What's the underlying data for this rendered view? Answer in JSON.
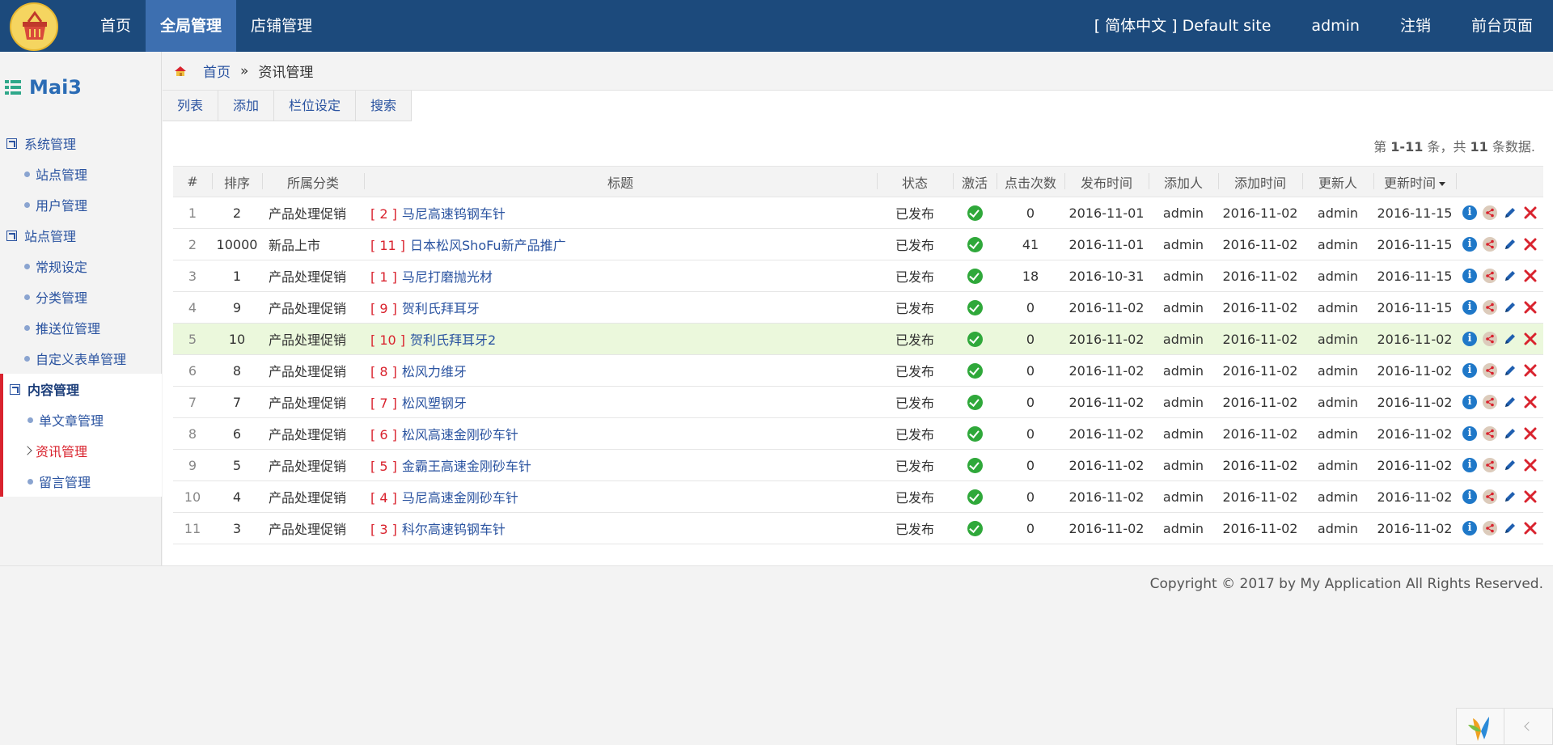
{
  "topnav": {
    "items": [
      {
        "label": "首页"
      },
      {
        "label": "全局管理",
        "active": true
      },
      {
        "label": "店铺管理"
      }
    ],
    "right": {
      "language": "[ 简体中文 ] Default site",
      "user": "admin",
      "logout": "注销",
      "frontend": "前台页面"
    }
  },
  "sidebar": {
    "brand": "Mai3",
    "groups": [
      {
        "label": "系统管理",
        "items": [
          "站点管理",
          "用户管理"
        ]
      },
      {
        "label": "站点管理",
        "items": [
          "常规设定",
          "分类管理",
          "推送位管理",
          "自定义表单管理"
        ]
      },
      {
        "label": "内容管理",
        "items": [
          "单文章管理",
          "资讯管理",
          "留言管理"
        ],
        "open": true,
        "active_item": "资讯管理"
      }
    ]
  },
  "breadcrumb": {
    "home": "首页",
    "sep": "»",
    "current": "资讯管理"
  },
  "tabs": [
    "列表",
    "添加",
    "栏位设定",
    "搜索"
  ],
  "summary": {
    "prefix": "第",
    "range": "1-11",
    "mid": "条，共",
    "total": "11",
    "suffix": "条数据."
  },
  "table": {
    "headers": [
      "#",
      "排序",
      "所属分类",
      "标题",
      "状态",
      "激活",
      "点击次数",
      "发布时间",
      "添加人",
      "添加时间",
      "更新人",
      "更新时间",
      ""
    ],
    "rows": [
      {
        "idx": "1",
        "sort": "2",
        "cat": "产品处理促销",
        "num": "[ 2 ]",
        "title": "马尼高速钨钢车针",
        "status": "已发布",
        "clicks": "0",
        "pub": "2016-11-01",
        "adder": "admin",
        "added": "2016-11-02",
        "updater": "admin",
        "updated": "2016-11-15"
      },
      {
        "idx": "2",
        "sort": "10000",
        "cat": "新品上市",
        "num": "[ 11 ]",
        "title": "日本松风ShoFu新产品推广",
        "status": "已发布",
        "clicks": "41",
        "pub": "2016-11-01",
        "adder": "admin",
        "added": "2016-11-02",
        "updater": "admin",
        "updated": "2016-11-15"
      },
      {
        "idx": "3",
        "sort": "1",
        "cat": "产品处理促销",
        "num": "[ 1 ]",
        "title": "马尼打磨抛光材",
        "status": "已发布",
        "clicks": "18",
        "pub": "2016-10-31",
        "adder": "admin",
        "added": "2016-11-02",
        "updater": "admin",
        "updated": "2016-11-15"
      },
      {
        "idx": "4",
        "sort": "9",
        "cat": "产品处理促销",
        "num": "[ 9 ]",
        "title": "贺利氏拜耳牙",
        "status": "已发布",
        "clicks": "0",
        "pub": "2016-11-02",
        "adder": "admin",
        "added": "2016-11-02",
        "updater": "admin",
        "updated": "2016-11-15"
      },
      {
        "idx": "5",
        "sort": "10",
        "cat": "产品处理促销",
        "num": "[ 10 ]",
        "title": "贺利氏拜耳牙2",
        "status": "已发布",
        "clicks": "0",
        "pub": "2016-11-02",
        "adder": "admin",
        "added": "2016-11-02",
        "updater": "admin",
        "updated": "2016-11-02",
        "highlight": true
      },
      {
        "idx": "6",
        "sort": "8",
        "cat": "产品处理促销",
        "num": "[ 8 ]",
        "title": "松风力维牙",
        "status": "已发布",
        "clicks": "0",
        "pub": "2016-11-02",
        "adder": "admin",
        "added": "2016-11-02",
        "updater": "admin",
        "updated": "2016-11-02"
      },
      {
        "idx": "7",
        "sort": "7",
        "cat": "产品处理促销",
        "num": "[ 7 ]",
        "title": "松风塑钢牙",
        "status": "已发布",
        "clicks": "0",
        "pub": "2016-11-02",
        "adder": "admin",
        "added": "2016-11-02",
        "updater": "admin",
        "updated": "2016-11-02"
      },
      {
        "idx": "8",
        "sort": "6",
        "cat": "产品处理促销",
        "num": "[ 6 ]",
        "title": "松风高速金刚砂车针",
        "status": "已发布",
        "clicks": "0",
        "pub": "2016-11-02",
        "adder": "admin",
        "added": "2016-11-02",
        "updater": "admin",
        "updated": "2016-11-02"
      },
      {
        "idx": "9",
        "sort": "5",
        "cat": "产品处理促销",
        "num": "[ 5 ]",
        "title": "金霸王高速金刚砂车针",
        "status": "已发布",
        "clicks": "0",
        "pub": "2016-11-02",
        "adder": "admin",
        "added": "2016-11-02",
        "updater": "admin",
        "updated": "2016-11-02"
      },
      {
        "idx": "10",
        "sort": "4",
        "cat": "产品处理促销",
        "num": "[ 4 ]",
        "title": "马尼高速金刚砂车针",
        "status": "已发布",
        "clicks": "0",
        "pub": "2016-11-02",
        "adder": "admin",
        "added": "2016-11-02",
        "updater": "admin",
        "updated": "2016-11-02"
      },
      {
        "idx": "11",
        "sort": "3",
        "cat": "产品处理促销",
        "num": "[ 3 ]",
        "title": "科尔高速钨钢车针",
        "status": "已发布",
        "clicks": "0",
        "pub": "2016-11-02",
        "adder": "admin",
        "added": "2016-11-02",
        "updater": "admin",
        "updated": "2016-11-02"
      }
    ]
  },
  "footer": {
    "copyright": "Copyright © 2017 by My Application All Rights Reserved."
  },
  "colors": {
    "topbar": "#1c4a7c",
    "active_nav": "#3d6fb0",
    "link": "#2a53a0",
    "red": "#d9232e",
    "highlight_row": "#ebf8dc"
  }
}
